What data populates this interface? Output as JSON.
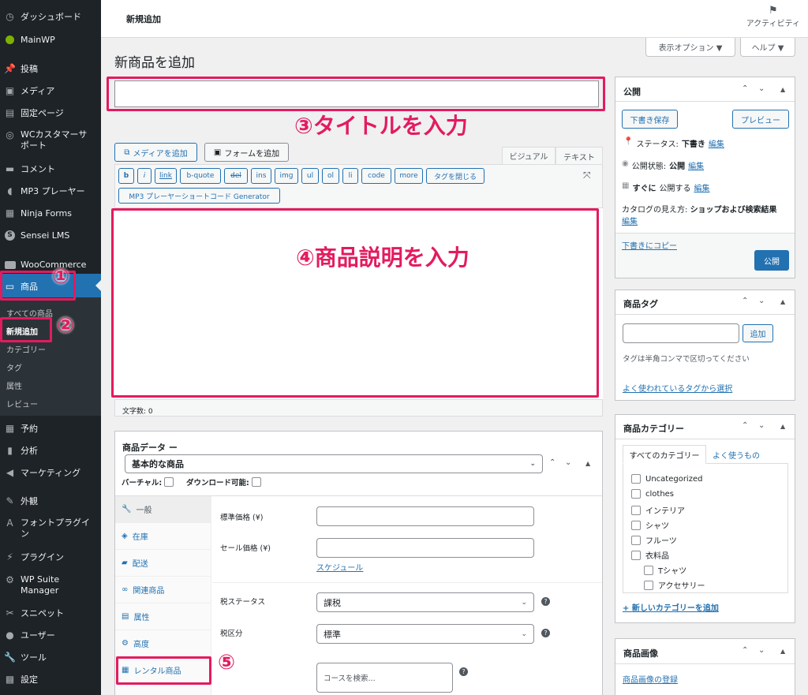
{
  "sidebar": {
    "items": [
      {
        "label": "ダッシュボード",
        "icon": "dashboard-icon"
      },
      {
        "label": "MainWP",
        "icon": "mainwp-icon"
      },
      {
        "label": "投稿",
        "icon": "pin-icon"
      },
      {
        "label": "メディア",
        "icon": "media-icon"
      },
      {
        "label": "固定ページ",
        "icon": "page-icon"
      },
      {
        "label": "WCカスタマーサポート",
        "icon": "support-icon"
      },
      {
        "label": "コメント",
        "icon": "comment-icon"
      },
      {
        "label": "MP3 プレーヤー",
        "icon": "audio-icon"
      },
      {
        "label": "Ninja Forms",
        "icon": "forms-icon"
      },
      {
        "label": "Sensei LMS",
        "icon": "sensei-icon"
      },
      {
        "label": "WooCommerce",
        "icon": "woo-icon"
      },
      {
        "label": "商品",
        "icon": "archive-icon"
      },
      {
        "label": "予約",
        "icon": "calendar-icon"
      },
      {
        "label": "分析",
        "icon": "chart-icon"
      },
      {
        "label": "マーケティング",
        "icon": "megaphone-icon"
      },
      {
        "label": "外観",
        "icon": "brush-icon"
      },
      {
        "label": "フォントプラグイン",
        "icon": "font-icon"
      },
      {
        "label": "プラグイン",
        "icon": "plugin-icon"
      },
      {
        "label": "WP Suite Manager",
        "icon": "gear-icon"
      },
      {
        "label": "スニペット",
        "icon": "scissors-icon"
      },
      {
        "label": "ユーザー",
        "icon": "user-icon"
      },
      {
        "label": "ツール",
        "icon": "wrench-icon"
      },
      {
        "label": "設定",
        "icon": "settings-icon"
      }
    ],
    "submenu": [
      "すべての商品",
      "新規追加",
      "カテゴリー",
      "タグ",
      "属性",
      "レビュー"
    ]
  },
  "topbar": {
    "title": "新規追加",
    "activity": "アクティビティ"
  },
  "screen_options": "表示オプション ▼",
  "help": "ヘルプ ▼",
  "page_title": "新商品を追加",
  "editor": {
    "add_media": "メディアを追加",
    "add_form": "フォームを追加",
    "tab_visual": "ビジュアル",
    "tab_text": "テキスト",
    "quicktags": [
      "b",
      "i",
      "link",
      "b-quote",
      "del",
      "ins",
      "img",
      "ul",
      "ol",
      "li",
      "code",
      "more",
      "タグを閉じる"
    ],
    "mp3_generator": "MP3 プレーヤーショートコード Generator",
    "word_count": "文字数: 0"
  },
  "annotations": {
    "title": "③タイトルを入力",
    "description": "④商品説明を入力",
    "n1": "①",
    "n2": "②",
    "n5": "⑤"
  },
  "product_data": {
    "heading": "商品データ ー",
    "type": "基本的な商品",
    "virtual": "バーチャル:",
    "downloadable": "ダウンロード可能:",
    "tabs": [
      "一般",
      "在庫",
      "配送",
      "関連商品",
      "属性",
      "高度",
      "レンタル商品"
    ],
    "regular_price": "標準価格 (¥)",
    "sale_price": "セール価格 (¥)",
    "schedule": "スケジュール",
    "tax_status": "税ステータス",
    "tax_status_value": "課税",
    "tax_class": "税区分",
    "tax_class_value": "標準",
    "course_placeholder": "コースを検索..."
  },
  "publish": {
    "title": "公開",
    "save_draft": "下書き保存",
    "preview": "プレビュー",
    "status_label": "ステータス:",
    "status_value": "下書き",
    "visibility_label": "公開状態:",
    "visibility_value": "公開",
    "schedule_label": "すぐに",
    "schedule_rest": "公開する",
    "edit": "編集",
    "catalog_label": "カタログの見え方:",
    "catalog_value": "ショップおよび検索結果",
    "copy_draft": "下書きにコピー",
    "publish_btn": "公開"
  },
  "tags_box": {
    "title": "商品タグ",
    "add": "追加",
    "hint": "タグは半角コンマで区切ってください",
    "popular": "よく使われているタグから選択"
  },
  "categories_box": {
    "title": "商品カテゴリー",
    "tab_all": "すべてのカテゴリー",
    "tab_popular": "よく使うもの",
    "items": [
      "Uncategorized",
      "clothes",
      "インテリア",
      "シャツ",
      "フルーツ",
      "衣料品",
      "Tシャツ",
      "アクセサリー"
    ],
    "add_new": "+ 新しいカテゴリーを追加"
  },
  "image_box": {
    "title": "商品画像",
    "link": "商品画像の登録"
  },
  "colors": {
    "sidebar": "#1d2327",
    "accent": "#2271b1",
    "annotation": "#e31b5f"
  }
}
